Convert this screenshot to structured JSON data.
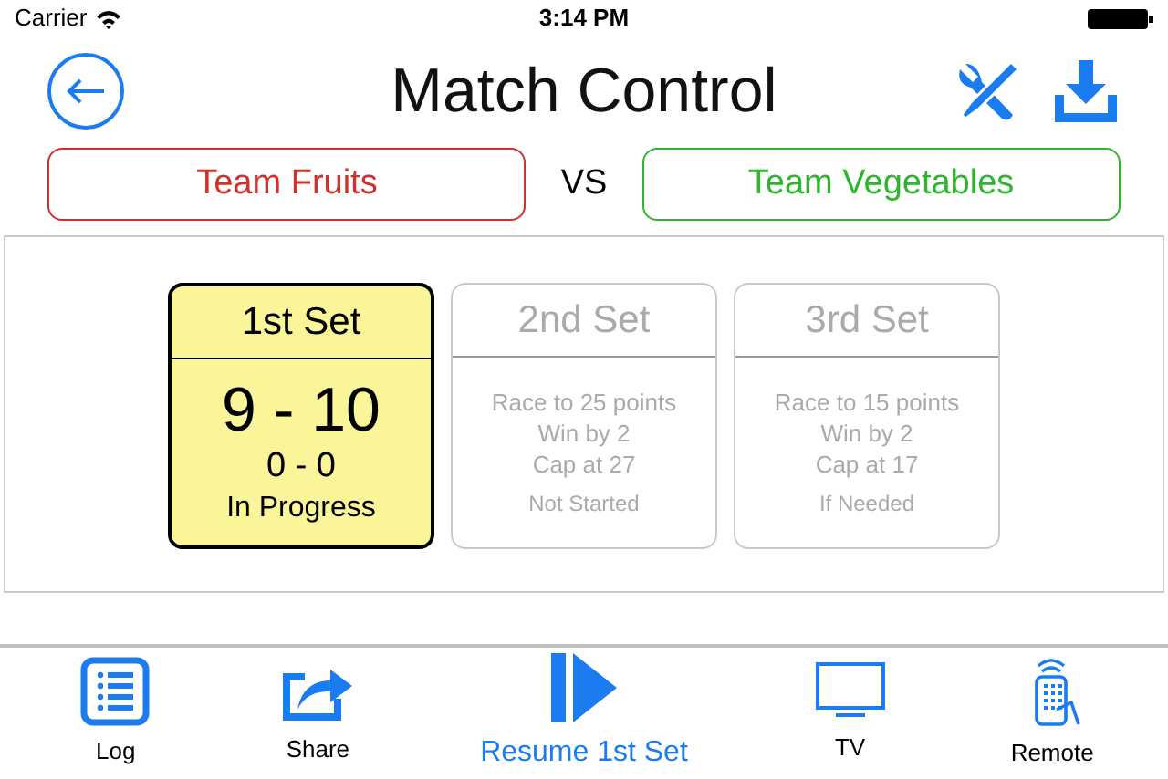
{
  "status_bar": {
    "carrier": "Carrier",
    "time": "3:14 PM"
  },
  "header": {
    "title": "Match Control"
  },
  "teams": [
    {
      "name": "Team Fruits",
      "color": "#d0312d"
    },
    {
      "name": "Team Vegetables",
      "color": "#2db52d"
    }
  ],
  "versus": "VS",
  "sets": [
    {
      "title": "1st Set",
      "selected": true,
      "score": "9 - 10",
      "set_score": "0 - 0",
      "status": "In Progress"
    },
    {
      "title": "2nd Set",
      "selected": false,
      "rules": [
        "Race to 25 points",
        "Win by 2",
        "Cap at 27"
      ],
      "status": "Not Started"
    },
    {
      "title": "3rd Set",
      "selected": false,
      "rules": [
        "Race to 15 points",
        "Win by 2",
        "Cap at 17"
      ],
      "status": "If Needed"
    }
  ],
  "toolbar": [
    {
      "label": "Log",
      "kind": "plain"
    },
    {
      "label": "Share",
      "kind": "plain"
    },
    {
      "label": "Resume 1st Set",
      "kind": "primary"
    },
    {
      "label": "TV",
      "kind": "plain"
    },
    {
      "label": "Remote",
      "kind": "plain"
    }
  ]
}
